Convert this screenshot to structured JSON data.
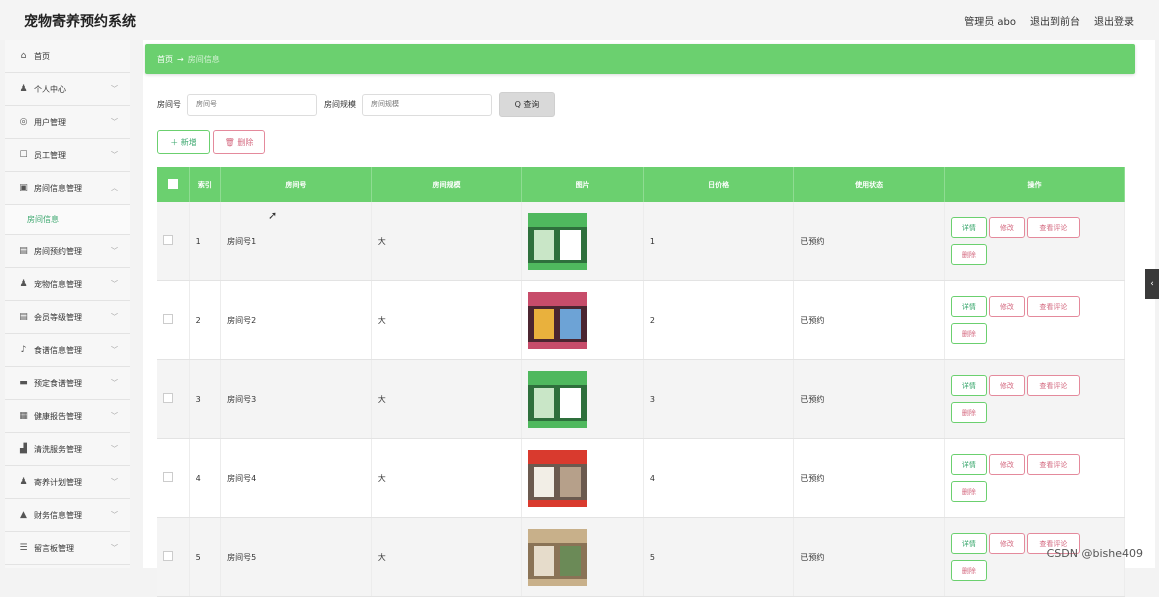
{
  "app": {
    "title": "宠物寄养预约系统"
  },
  "top_nav": {
    "admin": "管理员 abo",
    "front": "退出到前台",
    "logout": "退出登录"
  },
  "sidebar": {
    "items": [
      {
        "icon": "home-icon",
        "glyph": "⌂",
        "label": "首页"
      },
      {
        "icon": "user-icon",
        "glyph": "♟",
        "label": "个人中心"
      },
      {
        "icon": "globe-icon",
        "glyph": "◎",
        "label": "用户管理"
      },
      {
        "icon": "badge-icon",
        "glyph": "☐",
        "label": "员工管理"
      },
      {
        "icon": "room-icon",
        "glyph": "▣",
        "label": "房间信息管理"
      },
      {
        "icon": "clipboard-icon",
        "glyph": "▤",
        "label": "房间预约管理"
      },
      {
        "icon": "user-icon",
        "glyph": "♟",
        "label": "宠物信息管理"
      },
      {
        "icon": "clipboard-icon",
        "glyph": "▤",
        "label": "会员等级管理"
      },
      {
        "icon": "mic-icon",
        "glyph": "♪",
        "label": "食谱信息管理"
      },
      {
        "icon": "card-icon",
        "glyph": "▬",
        "label": "预定食谱管理"
      },
      {
        "icon": "grid-icon",
        "glyph": "▦",
        "label": "健康报告管理"
      },
      {
        "icon": "chart-icon",
        "glyph": "▟",
        "label": "清洗服务管理"
      },
      {
        "icon": "user-icon",
        "glyph": "♟",
        "label": "寄养计划管理"
      },
      {
        "icon": "bank-icon",
        "glyph": "▲",
        "label": "财务信息管理"
      },
      {
        "icon": "menu-icon",
        "glyph": "☰",
        "label": "留言板管理"
      }
    ],
    "submenu": "房间信息"
  },
  "breadcrumb": {
    "home": "首页",
    "arrow": "→",
    "current": "房间信息"
  },
  "search": {
    "room_no_label": "房间号",
    "room_no_placeholder": "房间号",
    "room_size_label": "房间规模",
    "room_size_placeholder": "房间规模",
    "button": "Q 查询"
  },
  "actions": {
    "add": "＋ 新增",
    "delete": "🗑 删除"
  },
  "table": {
    "headers": [
      "索引",
      "房间号",
      "房间规模",
      "图片",
      "日价格",
      "使用状态",
      "操作"
    ],
    "rows": [
      {
        "index": "1",
        "room": "房间号1",
        "size": "大",
        "price": "1",
        "status": "已预约",
        "img_color": "green"
      },
      {
        "index": "2",
        "room": "房间号2",
        "size": "大",
        "price": "2",
        "status": "已预约",
        "img_color": "colorful"
      },
      {
        "index": "3",
        "room": "房间号3",
        "size": "大",
        "price": "3",
        "status": "已预约",
        "img_color": "green"
      },
      {
        "index": "4",
        "room": "房间号4",
        "size": "大",
        "price": "4",
        "status": "已预约",
        "img_color": "red"
      },
      {
        "index": "5",
        "room": "房间号5",
        "size": "大",
        "price": "5",
        "status": "已预约",
        "img_color": "wood"
      }
    ],
    "ops": {
      "detail": "详情",
      "edit": "修改",
      "review": "查看评论",
      "delete": "删除"
    }
  },
  "watermark": "CSDN @bishe409",
  "colors": {
    "accent": "#6bd06f",
    "danger": "#d46a80"
  }
}
